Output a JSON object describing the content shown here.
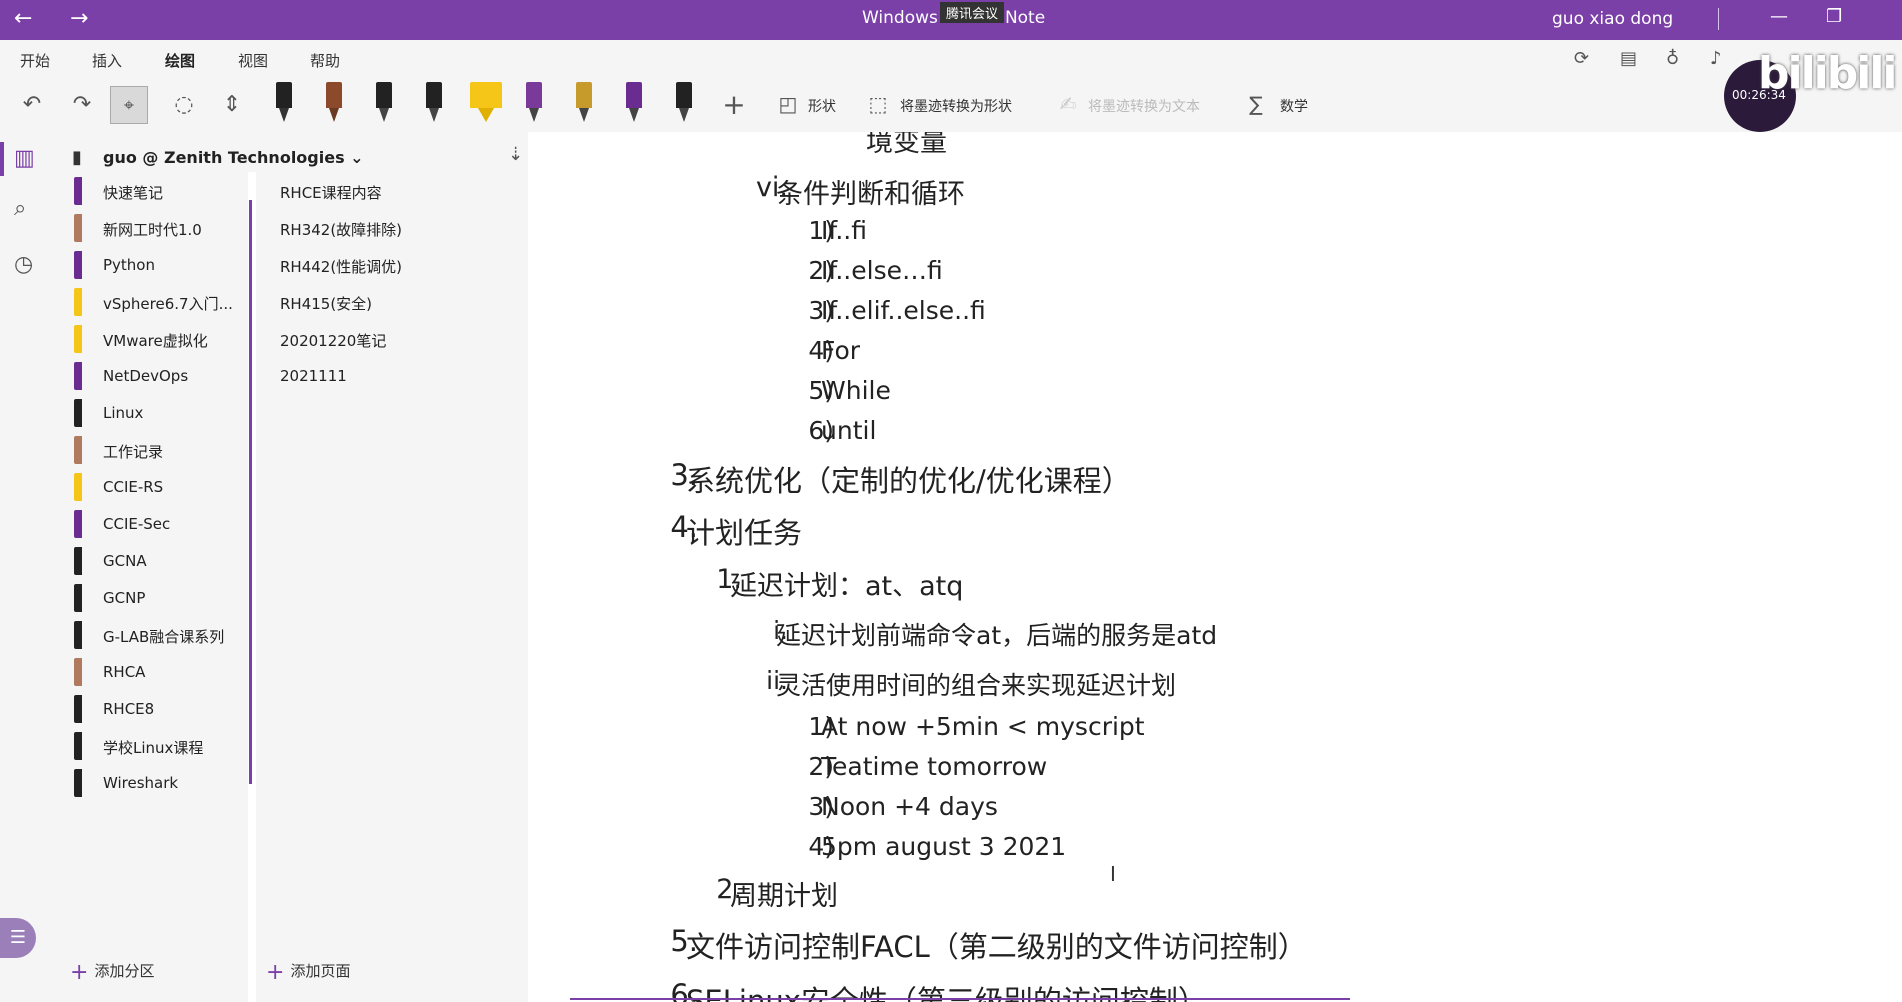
{
  "titlebar": {
    "title": "Windows 10 OneNote",
    "meeting_badge": "腾讯会议",
    "user": "guo xiao dong",
    "back_glyph": "←",
    "forward_glyph": "→",
    "minimize_glyph": "—",
    "restore_glyph": "❐",
    "close_glyph": "✕"
  },
  "menu": {
    "tabs": [
      "开始",
      "插入",
      "绘图",
      "视图",
      "帮助"
    ],
    "active_tab": "绘图"
  },
  "ribbon": {
    "shapes_label": "形状",
    "ink_to_shape_label": "将墨迹转换为形状",
    "ink_to_text_label": "将墨迹转换为文本",
    "math_label": "数学",
    "pens": [
      {
        "name": "pen-black-1",
        "color": "#222222",
        "tip": "#333333"
      },
      {
        "name": "pen-brown",
        "color": "#8b4a2b",
        "tip": "#6b3a22"
      },
      {
        "name": "pen-black-2",
        "color": "#222222",
        "tip": "#222222"
      },
      {
        "name": "pen-black-3",
        "color": "#222222",
        "tip": "#222222"
      },
      {
        "name": "highlighter-yellow",
        "color": "#f5c518",
        "tip": "#f5c518"
      },
      {
        "name": "pen-purple-pattern",
        "color": "#7a3a9a",
        "tip": "#222222"
      },
      {
        "name": "pen-gold",
        "color": "#c79b2b",
        "tip": "#222222"
      },
      {
        "name": "pen-purple",
        "color": "#6a2c91",
        "tip": "#222222"
      },
      {
        "name": "pen-black-4",
        "color": "#222222",
        "tip": "#222222"
      }
    ]
  },
  "notebook": {
    "name": "guo @ Zenith Technologies",
    "sections": [
      {
        "label": "快速笔记",
        "color": "#6a2c91"
      },
      {
        "label": "新网工时代1.0",
        "color": "#b07a60"
      },
      {
        "label": "Python",
        "color": "#6a2c91"
      },
      {
        "label": "vSphere6.7入门...",
        "color": "#f5c518"
      },
      {
        "label": "VMware虚拟化",
        "color": "#f5c518"
      },
      {
        "label": "NetDevOps",
        "color": "#6a2c91"
      },
      {
        "label": "Linux",
        "color": "#222222"
      },
      {
        "label": "工作记录",
        "color": "#b07a60"
      },
      {
        "label": "CCIE-RS",
        "color": "#f5c518"
      },
      {
        "label": "CCIE-Sec",
        "color": "#6a2c91"
      },
      {
        "label": "GCNA",
        "color": "#222222"
      },
      {
        "label": "GCNP",
        "color": "#222222"
      },
      {
        "label": "G-LAB融合课系列",
        "color": "#222222"
      },
      {
        "label": "RHCA",
        "color": "#b07a60"
      },
      {
        "label": "RHCE8",
        "color": "#222222"
      },
      {
        "label": "学校Linux课程",
        "color": "#222222"
      },
      {
        "label": "Wireshark",
        "color": "#222222"
      }
    ],
    "pages": [
      "RHCE课程内容",
      "RH342(故障排除)",
      "RH442(性能调优)",
      "RH415(安全)",
      "20201220笔记",
      "2021111"
    ],
    "add_section": "添加分区",
    "add_page": "添加页面"
  },
  "content": {
    "lines": [
      {
        "num": "",
        "text": "境变量",
        "level": "lv2"
      },
      {
        "num": "vi.",
        "text": "条件判断和循环",
        "level": "lv2"
      },
      {
        "num": "1)",
        "text": "If..fi",
        "level": "lv3"
      },
      {
        "num": "2)",
        "text": "If..else…fi",
        "level": "lv3"
      },
      {
        "num": "3)",
        "text": "If..elif..else..fi",
        "level": "lv3"
      },
      {
        "num": "4)",
        "text": "For",
        "level": "lv3"
      },
      {
        "num": "5)",
        "text": "While",
        "level": "lv3"
      },
      {
        "num": "6)",
        "text": "until",
        "level": "lv3"
      },
      {
        "num": "3.",
        "text": "系统优化（定制的优化/优化课程）",
        "level": "lv1"
      },
      {
        "num": "4.",
        "text": "计划任务",
        "level": "lv1"
      },
      {
        "num": "1.",
        "text": "延迟计划：at、atq",
        "level": "lv2"
      },
      {
        "num": "i.",
        "text": "延迟计划前端命令at，后端的服务是atd",
        "level": "lv3"
      },
      {
        "num": "ii.",
        "text": "灵活使用时间的组合来实现延迟计划",
        "level": "lv3"
      },
      {
        "num": "1)",
        "text": "At now +5min < myscript",
        "level": "lv3"
      },
      {
        "num": "2)",
        "text": "Teatime tomorrow",
        "level": "lv3"
      },
      {
        "num": "3)",
        "text": "Noon +4 days",
        "level": "lv3"
      },
      {
        "num": "4)",
        "text": "5pm august 3 2021",
        "level": "lv3"
      },
      {
        "num": "2.",
        "text": "周期计划",
        "level": "lv2"
      },
      {
        "num": "5.",
        "text": "文件访问控制FACL（第二级别的文件访问控制）",
        "level": "lv1"
      },
      {
        "num": "6.",
        "text": "SELinux安全性（第三级别的访问控制）",
        "level": "lv1"
      }
    ]
  },
  "watermark": {
    "text": "bilibili",
    "time_overlay": "00:26:34"
  }
}
